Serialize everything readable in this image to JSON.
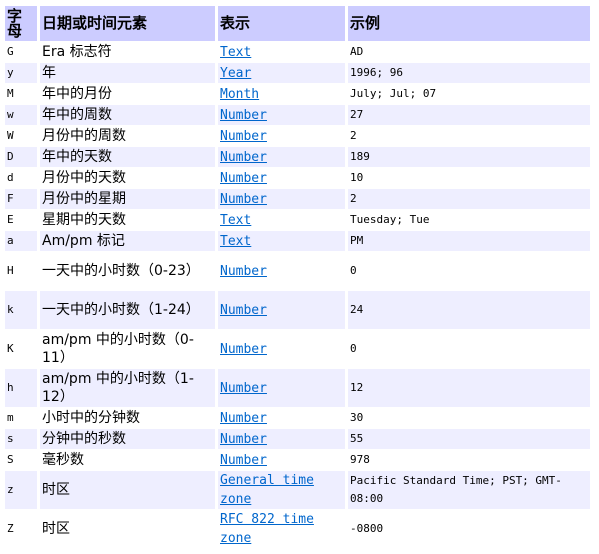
{
  "table": {
    "headers": [
      "字母",
      "日期或时间元素",
      "表示",
      "示例"
    ],
    "rows": [
      {
        "letter": "G",
        "element": "Era 标志符",
        "presentation": "Text",
        "example": "AD"
      },
      {
        "letter": "y",
        "element": "年",
        "presentation": "Year",
        "example": "1996; 96"
      },
      {
        "letter": "M",
        "element": "年中的月份",
        "presentation": "Month",
        "example": "July; Jul; 07"
      },
      {
        "letter": "w",
        "element": "年中的周数",
        "presentation": "Number",
        "example": "27"
      },
      {
        "letter": "W",
        "element": "月份中的周数",
        "presentation": "Number",
        "example": "2"
      },
      {
        "letter": "D",
        "element": "年中的天数",
        "presentation": "Number",
        "example": "189"
      },
      {
        "letter": "d",
        "element": "月份中的天数",
        "presentation": "Number",
        "example": "10"
      },
      {
        "letter": "F",
        "element": "月份中的星期",
        "presentation": "Number",
        "example": "2"
      },
      {
        "letter": "E",
        "element": "星期中的天数",
        "presentation": "Text",
        "example": "Tuesday; Tue"
      },
      {
        "letter": "a",
        "element": "Am/pm 标记",
        "presentation": "Text",
        "example": "PM"
      },
      {
        "letter": "H",
        "element": "一天中的小时数（0-23）",
        "presentation": "Number",
        "example": "0"
      },
      {
        "letter": "k",
        "element": "一天中的小时数（1-24）",
        "presentation": "Number",
        "example": "24"
      },
      {
        "letter": "K",
        "element": "am/pm 中的小时数（0-11）",
        "presentation": "Number",
        "example": "0"
      },
      {
        "letter": "h",
        "element": "am/pm 中的小时数（1-12）",
        "presentation": "Number",
        "example": "12"
      },
      {
        "letter": "m",
        "element": "小时中的分钟数",
        "presentation": "Number",
        "example": "30"
      },
      {
        "letter": "s",
        "element": "分钟中的秒数",
        "presentation": "Number",
        "example": "55"
      },
      {
        "letter": "S",
        "element": "毫秒数",
        "presentation": "Number",
        "example": "978"
      },
      {
        "letter": "z",
        "element": "时区",
        "presentation": "General time zone",
        "example": "Pacific Standard Time; PST; GMT-08:00"
      },
      {
        "letter": "Z",
        "element": "时区",
        "presentation": "RFC 822 time zone",
        "example": "-0800"
      }
    ]
  },
  "colors": {
    "header_bg": "#ccccff",
    "alt_row_bg": "#eeeeff",
    "link": "#0066cc"
  }
}
